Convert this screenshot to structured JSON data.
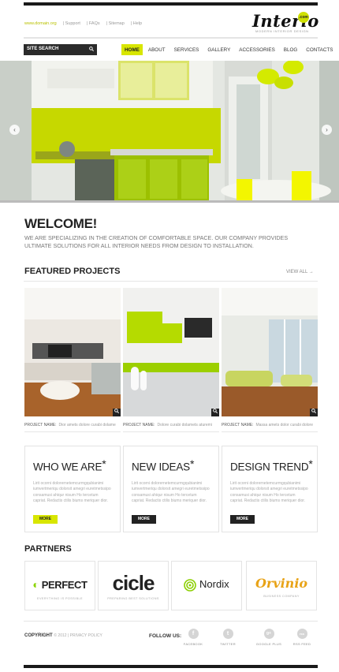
{
  "header": {
    "top_links": [
      "www.domain.org",
      "Support",
      "FAQs",
      "Sitemap",
      "Help"
    ],
    "logo_title": "Interio",
    "logo_badge": ".com",
    "logo_tagline": "MODERN INTERIOR DESIGN"
  },
  "search": {
    "label": "SITE SEARCH"
  },
  "nav": {
    "items": [
      "HOME",
      "ABOUT",
      "SERVICES",
      "GALLERY",
      "ACCESSORIES",
      "BLOG",
      "CONTACTS"
    ],
    "active": "HOME"
  },
  "slider": {
    "prev_glyph": "‹",
    "next_glyph": "›"
  },
  "welcome": {
    "title": "WELCOME!",
    "text": "We are specializing in the creation of comfortable space. Our company provides ultimate solutions for all interior needs from design to installation."
  },
  "featured": {
    "title": "FEATURED PROJECTS",
    "view_all": "VIEW ALL →",
    "projects": [
      {
        "label": "PROJECT NAME:",
        "desc": "Dior amets dolore curabi dolame"
      },
      {
        "label": "PROJECT NAME:",
        "desc": "Dolore curabi dolamets aturemi"
      },
      {
        "label": "PROJECT NAME:",
        "desc": "Massa amets dolor curabi dolore"
      }
    ]
  },
  "boxes": [
    {
      "title": "WHO WE ARE",
      "star": "*",
      "text": "Lirit ocorni dolorernetemcurmgqubianimi iumvertmeriqu dolorsit amegri euretmetssipo consamusi ahiqur nisum Ho tercetum capriat. Redactis ctilis biums meriquer dior.",
      "button": "MORE",
      "button_style": "accent"
    },
    {
      "title": "NEW IDEAS",
      "star": "*",
      "text": "Lirit ocorni dolorernetemcurmgqubianimi iumvertmeriqu dolorsit amegri euretmetssipo consamusi ahiqur nisum Ho tercetum capriat. Redactis ctilis biums meriquer dior.",
      "button": "MORE",
      "button_style": "dark"
    },
    {
      "title": "DESIGN TREND",
      "star": "*",
      "text": "Lirit ocorni dolorernetemcurmgqubianimi iumvertmeriqu dolorsit amegri euretmetssipo consamusi ahiqur nisum Ho tercetum capriat. Redactis ctilis biums meriquer dior.",
      "button": "MORE",
      "button_style": "dark"
    }
  ],
  "partners": {
    "title": "PARTNERS",
    "items": [
      {
        "name": "PERFECT",
        "tagline": "EVERYTHING IS POSSIBLE"
      },
      {
        "name": "cicle",
        "tagline": "PREPARING BEST SOLUTIONS"
      },
      {
        "name": "Nordix",
        "tagline": ""
      },
      {
        "name": "Orvinio",
        "tagline": "BUSINESS COMPANY"
      }
    ]
  },
  "footer": {
    "copyright_label": "COPYRIGHT",
    "copyright_text": "© 2012 | PRIVACY POLICY",
    "follow_label": "FOLLOW US:",
    "social": [
      {
        "glyph": "f",
        "label": "FACEBOOK",
        "icon": "facebook-icon"
      },
      {
        "glyph": "t",
        "label": "TWITTER",
        "icon": "twitter-icon"
      },
      {
        "glyph": "g+",
        "label": "GOOGLE PLUS",
        "icon": "google-plus-icon"
      },
      {
        "glyph": "rss",
        "label": "RSS FEED",
        "icon": "rss-icon"
      }
    ]
  },
  "colors": {
    "accent": "#d8e600",
    "dark": "#222222",
    "text_muted": "#999999"
  }
}
